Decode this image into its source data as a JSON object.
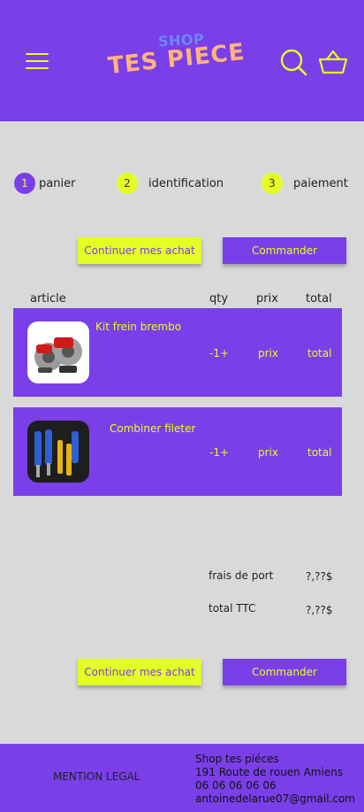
{
  "header": {
    "logo_top": "SHOP",
    "logo_bottom": "TES PIECE",
    "menu_icon": "hamburger-menu-icon",
    "search_icon": "search-icon",
    "cart_icon": "basket-icon"
  },
  "steps": [
    {
      "num": "1",
      "label": "panier"
    },
    {
      "num": "2",
      "label": "identification"
    },
    {
      "num": "3",
      "label": "paiement"
    }
  ],
  "actions": {
    "continue_label": "Continuer mes achat",
    "order_label": "Commander"
  },
  "table": {
    "headers": [
      "article",
      "qty",
      "prix",
      "total"
    ],
    "rows": [
      {
        "name": "Kit frein brembo",
        "qty": "-1+",
        "price": "prix",
        "total": "total"
      },
      {
        "name": "Combiner fileter",
        "qty": "-1+",
        "price": "prix",
        "total": "total"
      }
    ]
  },
  "totals": {
    "shipping_label": "frais de port",
    "shipping_value": "?,??$",
    "total_label": "total TTC",
    "total_value": "?,??$"
  },
  "footer": {
    "legal": "MENTION LEGAL",
    "contact": [
      "Shop tes piéces",
      "191 Route de rouen Amiens",
      "06 06 06 06 06",
      "antoinedelarue07@gmail.com"
    ]
  },
  "colors": {
    "primary": "#7a3fe8",
    "accent": "#e4ff23",
    "background": "#d9d9d9"
  }
}
